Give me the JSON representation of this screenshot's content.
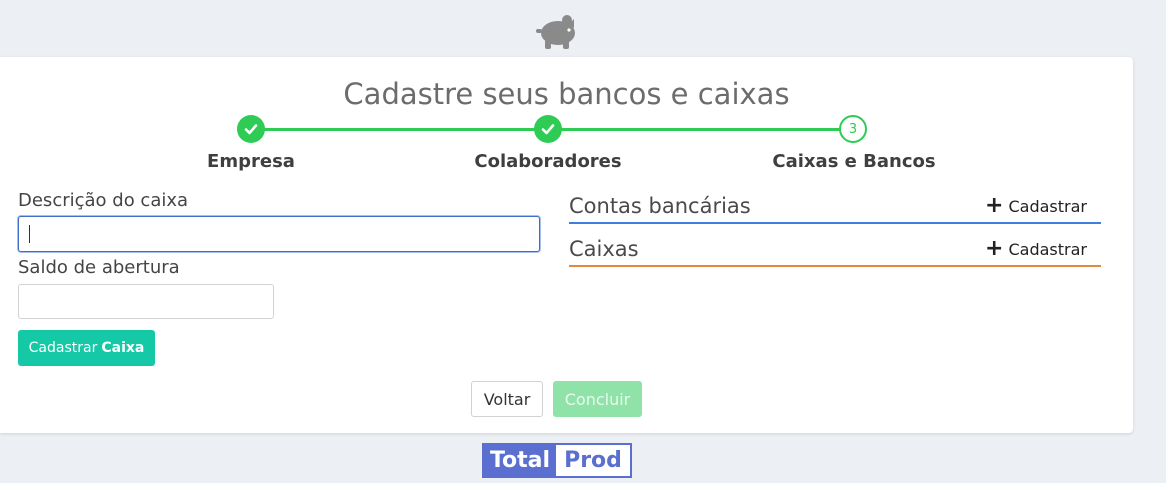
{
  "header": {
    "logo_icon": "piggy-bank-icon"
  },
  "wizard": {
    "title": "Cadastre seus bancos e caixas",
    "steps": [
      {
        "label": "Empresa",
        "state": "done",
        "icon": "check-icon"
      },
      {
        "label": "Colaboradores",
        "state": "done",
        "icon": "check-icon"
      },
      {
        "label": "Caixas e Bancos",
        "state": "current",
        "number": "3"
      }
    ],
    "accent_color": "#2ecc55"
  },
  "form": {
    "descricao_label": "Descrição do caixa",
    "descricao_value": "",
    "saldo_label": "Saldo de abertura",
    "saldo_value": "",
    "submit_label_prefix": "Cadastrar",
    "submit_label_bold": "Caixa"
  },
  "sections": [
    {
      "title": "Contas bancárias",
      "action": "Cadastrar",
      "color": "#3d7ee0"
    },
    {
      "title": "Caixas",
      "action": "Cadastrar",
      "color": "#e08a3d"
    }
  ],
  "footer_buttons": {
    "back": "Voltar",
    "finish": "Concluir"
  },
  "brand": {
    "part1": "Total",
    "part2": "Prod",
    "color": "#5a6fcf"
  }
}
